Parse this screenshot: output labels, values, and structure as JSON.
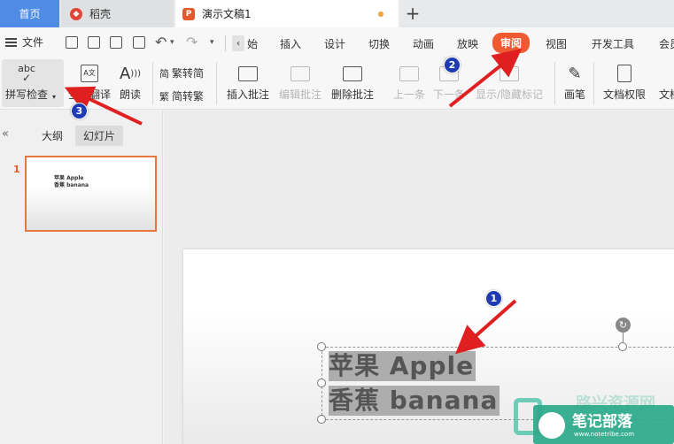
{
  "tabs": {
    "home": "首页",
    "daoke": "稻壳",
    "doc": "演示文稿1",
    "add": "+"
  },
  "menu": {
    "file": "文件",
    "items": [
      "始",
      "插入",
      "设计",
      "切换",
      "动画",
      "放映",
      "审阅",
      "视图",
      "开发工具",
      "会员"
    ],
    "active": "审阅"
  },
  "ribbon": {
    "spell_check": "拼写检查",
    "spell_icon_text": "abc",
    "translate": "全文翻译",
    "read_aloud": "朗读",
    "trad_to_simp": "繁转简",
    "simp_to_trad": "简转繁",
    "insert_comment": "插入批注",
    "edit_comment": "编辑批注",
    "delete_comment": "删除批注",
    "prev": "上一条",
    "next": "下一条",
    "show_hide": "显示/隐藏标记",
    "pen": "画笔",
    "permission": "文档权限",
    "more": "文档"
  },
  "left_pane": {
    "collapse": "«",
    "outline": "大纲",
    "slides": "幻灯片",
    "slide_number": "1",
    "thumb_line1": "苹果 Apple",
    "thumb_line2": "香蕉 banana"
  },
  "slide": {
    "line1": "苹果 Apple",
    "line2": "香蕉 banana"
  },
  "annotations": {
    "badge1": "1",
    "badge2": "2",
    "badge3": "3",
    "arrow_color": "#e02020"
  },
  "watermark": {
    "name": "笔记部落",
    "url": "www.notetribe.com",
    "faded": "路兴资源网"
  },
  "colors": {
    "accent": "#ef5a32",
    "home_tab": "#4e8ce6",
    "thumb_border": "#e6783f",
    "badge": "#1e3bb3"
  }
}
